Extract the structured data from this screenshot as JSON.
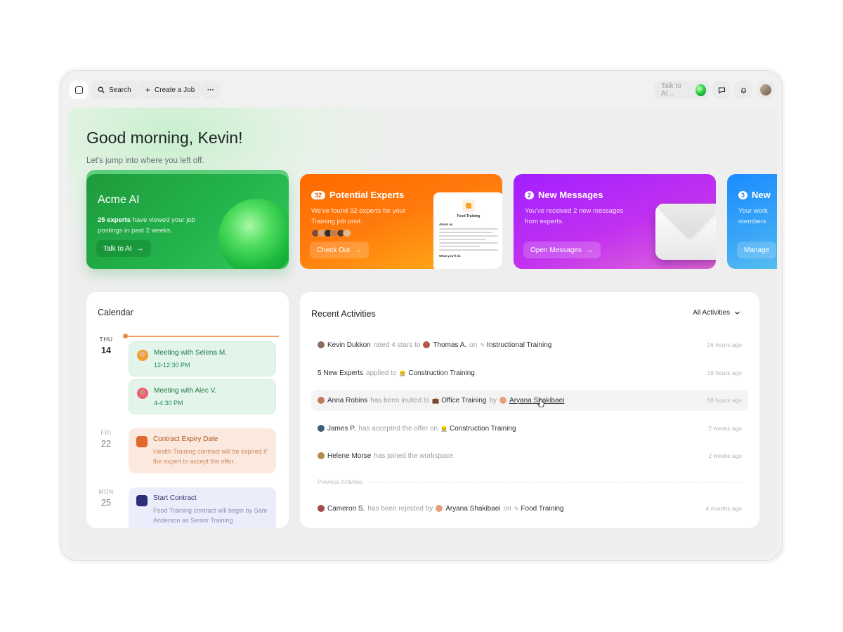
{
  "topbar": {
    "search_label": "Search",
    "create_label": "Create a Job",
    "more_label": "···",
    "ai_placeholder": "Talk to AI..."
  },
  "greeting": {
    "title": "Good morning, Kevin!",
    "subtitle": "Let's jump into where you left off."
  },
  "cards": {
    "acme": {
      "title": "Acme AI",
      "desc_bold": "25 experts",
      "desc_rest": " have viewed your job postings in past 2 weeks.",
      "button": "Talk to AI"
    },
    "experts": {
      "count": "32",
      "title": "Potential Experts",
      "desc": "We've found 32 experts for your Training job post.",
      "button": "Check Out",
      "doc_title": "Food Training",
      "doc_heading1": "About us",
      "doc_heading2": "What you'll do"
    },
    "messages": {
      "count": "2",
      "title": "New Messages",
      "desc": "You've received 2 new messages from experts.",
      "button": "Open Messages"
    },
    "team": {
      "count": "3",
      "title": "New",
      "desc": "Your work members",
      "button": "Manage"
    }
  },
  "calendar": {
    "title": "Calendar",
    "days": [
      {
        "name": "THU",
        "date": "14"
      },
      {
        "name": "FRI",
        "date": "22"
      },
      {
        "name": "MON",
        "date": "25"
      }
    ],
    "events": [
      {
        "title": "Meeting with Selena M.",
        "sub": "12-12:30 PM"
      },
      {
        "title": "Meeting with Alec V.",
        "sub": "4-4:30 PM"
      },
      {
        "title": "Contract Expiry Date",
        "sub": "Health Training contract will be expired if the expert to accept the offer."
      },
      {
        "title": "Start Contract",
        "sub": "Food Training contract will begin by Sam Anderson as Senior Training"
      }
    ]
  },
  "activities": {
    "title": "Recent Activities",
    "filter": "All Activities",
    "previous_label": "Previous Activities",
    "rows": [
      {
        "actor": "Kevin Dukkon",
        "verb": "rated 4 stars to",
        "target": "Thomas A.",
        "prep": "on",
        "object": "Instructional Training",
        "time": "16 hours ago"
      },
      {
        "actor": "5 New Experts",
        "verb": "applied to",
        "object": "Construction Training",
        "time": "18 hours ago"
      },
      {
        "actor": "Anna Robins",
        "verb": "has been invited to",
        "object": "Office Training",
        "prep": "by",
        "target": "Aryana Shakibaei",
        "time": "18 hours ago"
      },
      {
        "actor": "James P.",
        "verb": "has accepted the offer on",
        "object": "Construction Training",
        "time": "2 weeks ago"
      },
      {
        "actor": "Helene Morse",
        "verb": "has joined the workspace",
        "time": "2 weeks ago"
      },
      {
        "actor": "Cameron S.",
        "verb": "has been rejected by",
        "target": "Aryana Shakibaei",
        "prep": "on",
        "object": "Food Training",
        "time": "4 months ago"
      }
    ]
  },
  "colors": {
    "acme_green": "#22b14b",
    "experts_orange": "#ff7a0c",
    "messages_purple": "#c231f0",
    "team_blue": "#1b8cff"
  }
}
